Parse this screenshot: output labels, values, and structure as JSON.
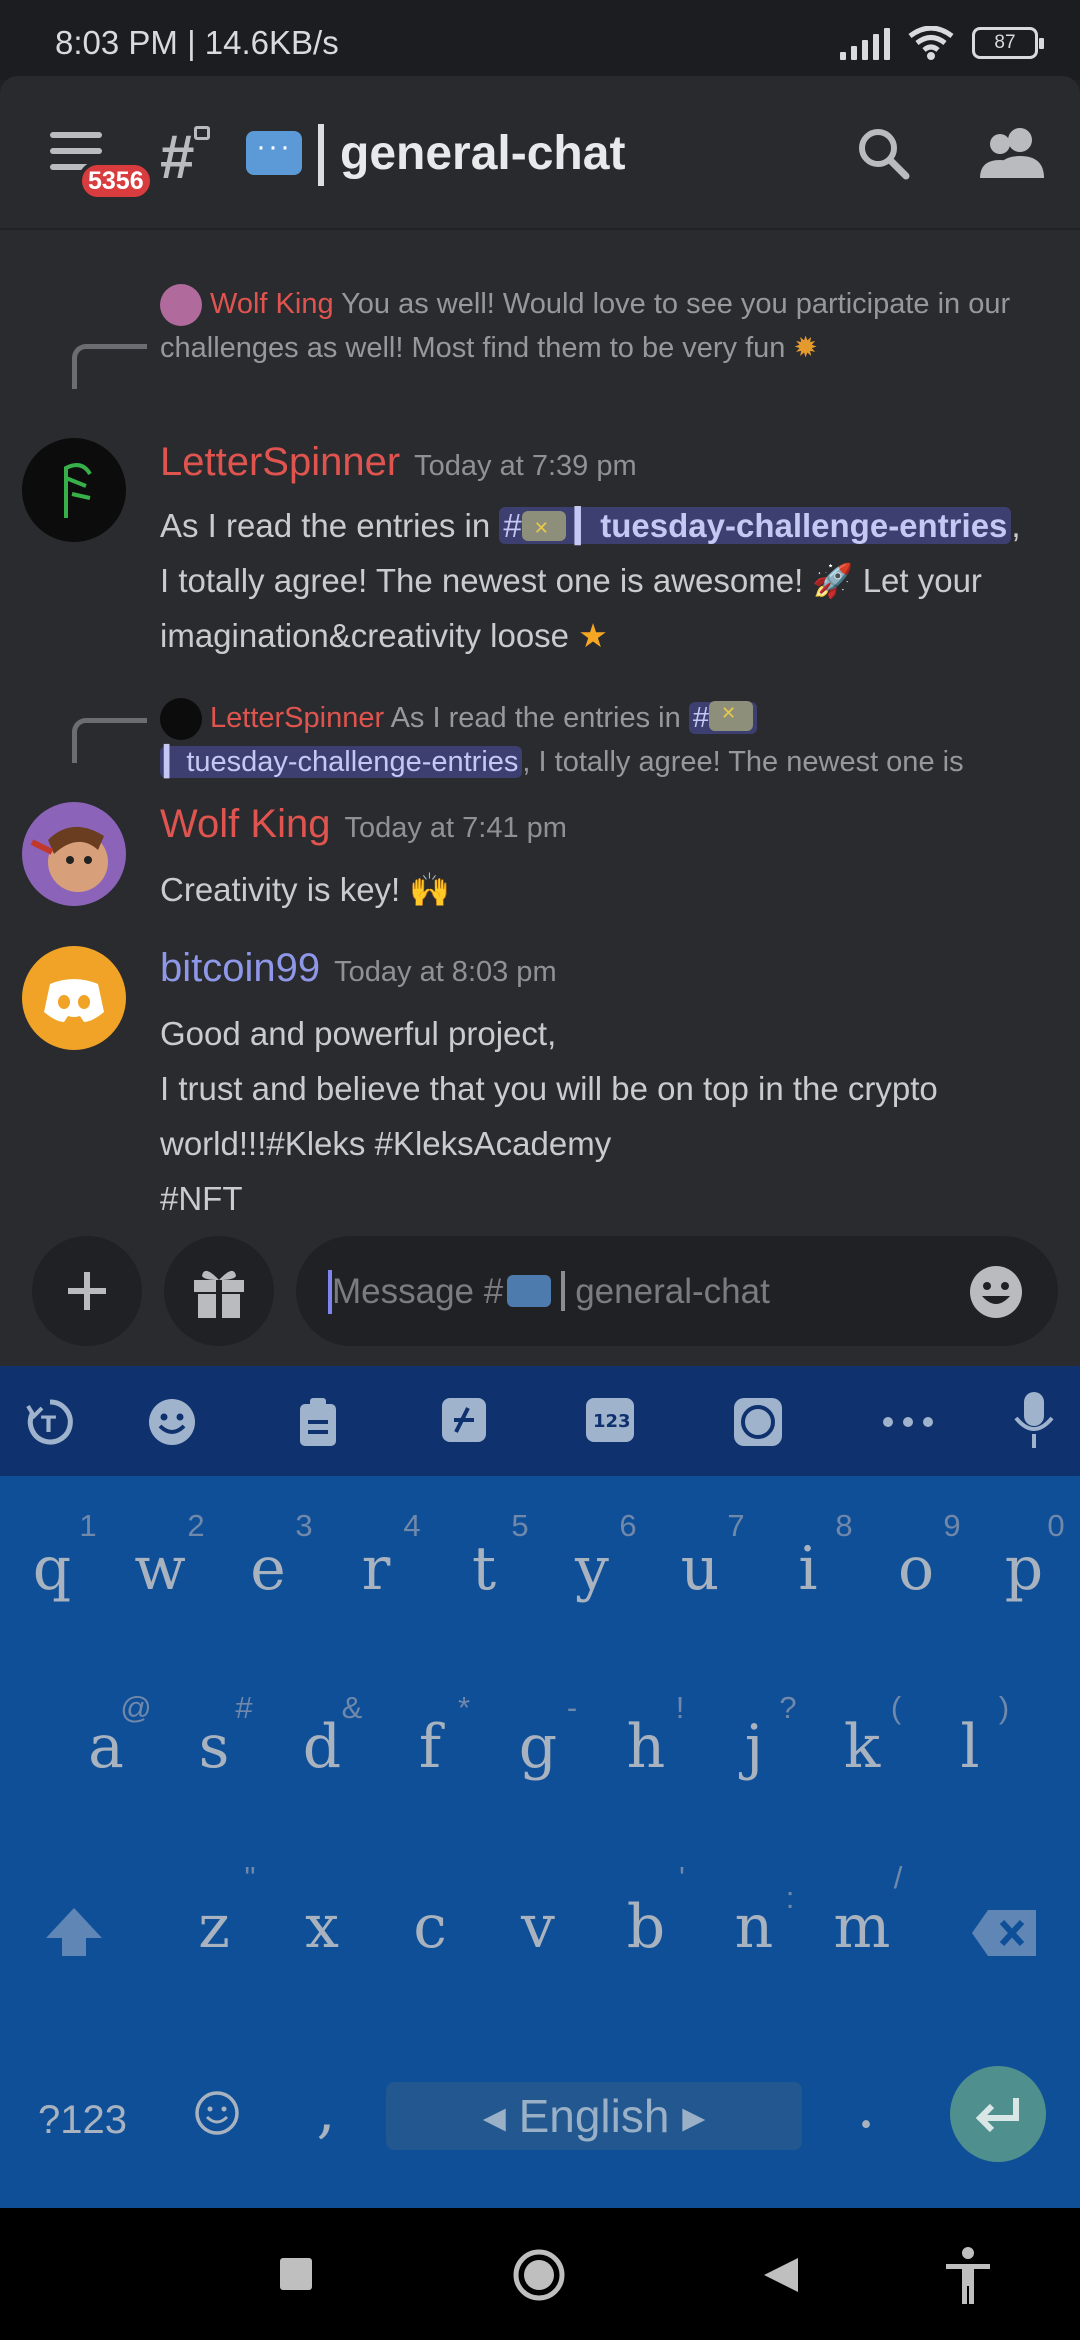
{
  "status": {
    "time": "8:03 PM | 14.6KB/s",
    "battery": "87"
  },
  "header": {
    "unread_badge": "5356",
    "channel_name": "general-chat"
  },
  "messages": [
    {
      "reply_to": {
        "author": "Wolf King",
        "text": "You as well! Would love to see you participate in our challenges as well! Most find them to be very fun"
      },
      "author": "LetterSpinner",
      "author_color": "#e0544f",
      "timestamp": "Today at 7:39 pm",
      "text_before_mention": "As I read the entries in",
      "mention": "tuesday-challenge-entries",
      "text_line2": "I totally agree! The newest one is awesome!",
      "text_line2b": "Let your",
      "text_line3": "imagination&creativity loose"
    },
    {
      "reply_to": {
        "author": "LetterSpinner",
        "text_before_mention": "As I read the entries in",
        "mention": "tuesday-challenge-entries",
        "text_after_mention": ", I totally agree! The newest one is"
      },
      "author": "Wolf King",
      "author_color": "#e0544f",
      "timestamp": "Today at 7:41 pm",
      "text": "Creativity is key!"
    },
    {
      "author": "bitcoin99",
      "author_color": "#8f97e8",
      "timestamp": "Today at 8:03 pm",
      "lines": [
        "Good and powerful project,",
        "I trust and believe that you will be on top in the crypto",
        "world!!!#Kleks #KleksAcademy",
        "#NFT"
      ]
    }
  ],
  "composer": {
    "placeholder_prefix": "Message #",
    "placeholder_channel": "general-chat"
  },
  "keyboard": {
    "numbers": [
      "1",
      "2",
      "3",
      "4",
      "5",
      "6",
      "7",
      "8",
      "9",
      "0"
    ],
    "row1": [
      "q",
      "w",
      "e",
      "r",
      "t",
      "y",
      "u",
      "i",
      "o",
      "p"
    ],
    "row2_hints": [
      "@",
      "#",
      "&",
      "*",
      "-",
      "!",
      "?",
      "(",
      ")"
    ],
    "row2": [
      "a",
      "s",
      "d",
      "f",
      "g",
      "h",
      "j",
      "k",
      "l"
    ],
    "row3_hints": [
      "\"",
      "'",
      ":",
      "/"
    ],
    "row3": [
      "z",
      "x",
      "c",
      "v",
      "b",
      "n",
      "m"
    ],
    "symbols_key": "?123",
    "comma": ",",
    "language": "English",
    "period": "."
  },
  "icons": {
    "menu": "hamburger-icon",
    "search": "search-icon",
    "members": "members-icon",
    "add": "plus-icon",
    "gift": "gift-icon",
    "emoji": "emoji-icon",
    "mic": "microphone-icon"
  },
  "colors": {
    "background": "#2a2b2e",
    "mention_bg": "#3c3f70",
    "keyboard": "#0f4f98",
    "badge": "#d83c3e"
  }
}
